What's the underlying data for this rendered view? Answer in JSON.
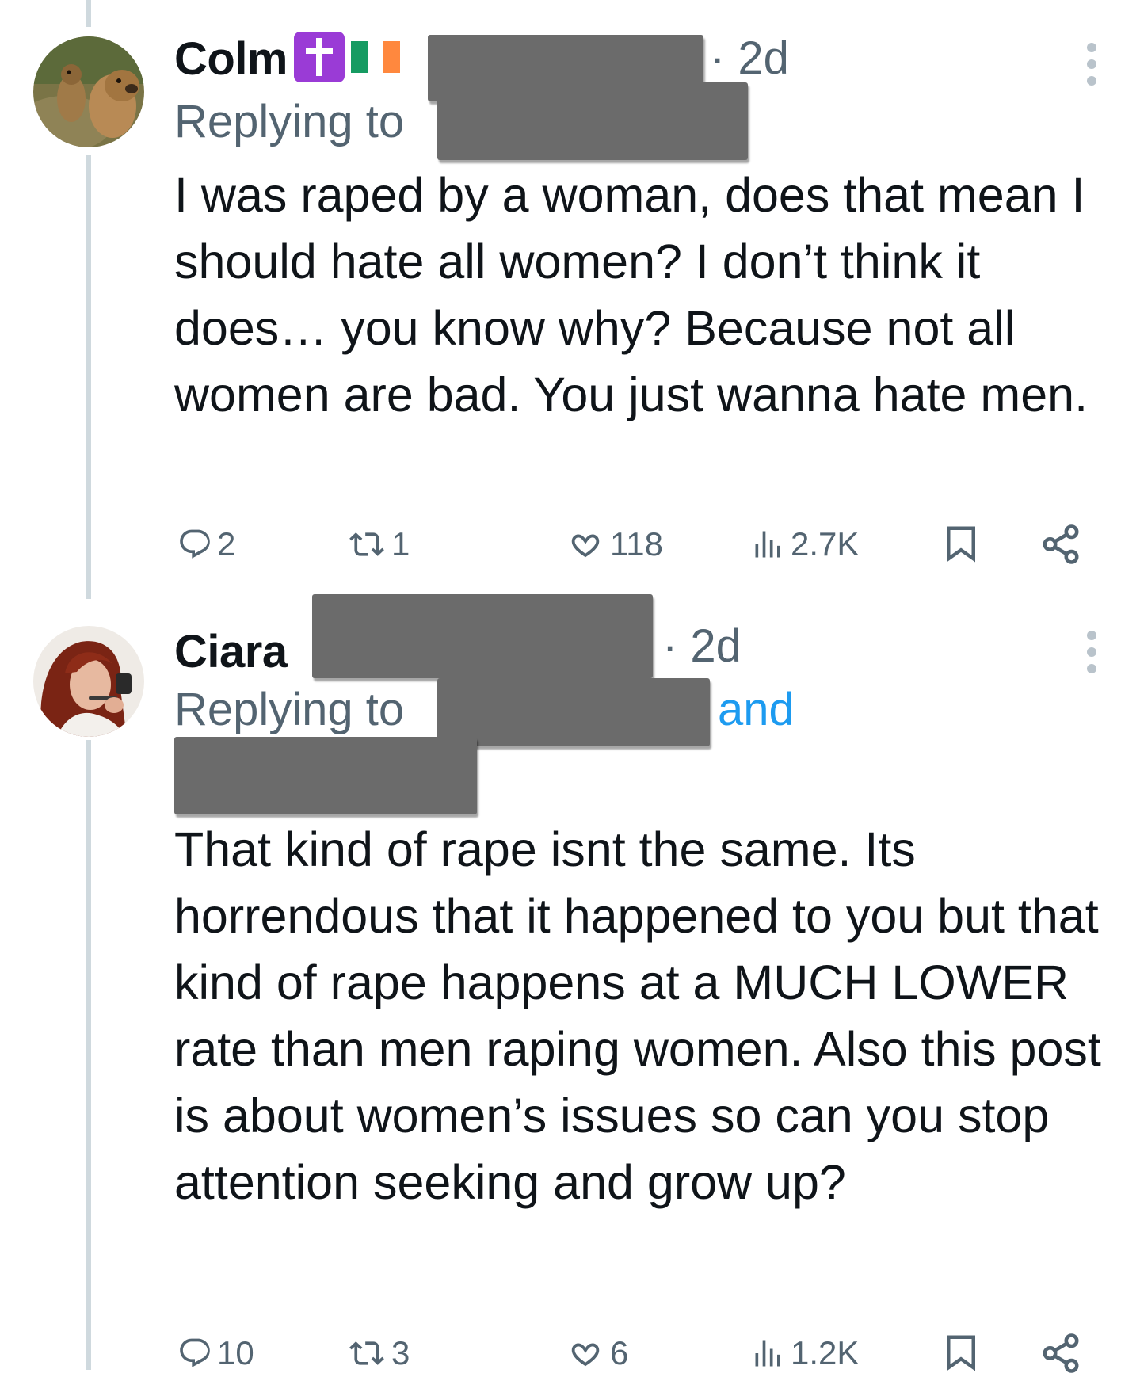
{
  "tweets": [
    {
      "display_name": "Colm",
      "badges": [
        "latin-cross-emoji",
        "ireland-flag-emoji"
      ],
      "time": "· 2d",
      "replying_label": "Replying to",
      "body": "I was raped by a woman, does that mean I should hate all women? I don’t think it does… you know why? Because not all women are bad. You just wanna hate men.",
      "stats": {
        "replies": "2",
        "retweets": "1",
        "likes": "118",
        "views": "2.7K"
      }
    },
    {
      "display_name": "Ciara",
      "time": "· 2d",
      "replying_label": "Replying to",
      "and_label": "and",
      "body": "That kind of rape isnt the same. Its horrendous that it happened to you but that kind of rape happens at a MUCH LOWER rate than men raping women. Also this post is about women’s issues so can you stop attention seeking and grow up?",
      "stats": {
        "replies": "10",
        "retweets": "3",
        "likes": "6",
        "views": "1.2K"
      }
    }
  ],
  "icons": {
    "reply": "reply-icon",
    "retweet": "retweet-icon",
    "like": "heart-icon",
    "views": "views-icon",
    "bookmark": "bookmark-icon",
    "share": "share-icon",
    "more": "more-icon"
  },
  "colors": {
    "text": "#0f1419",
    "secondary": "#536471",
    "link": "#1d9bf0",
    "thread_line": "#cfd9de",
    "redaction": "#6b6b6b"
  }
}
